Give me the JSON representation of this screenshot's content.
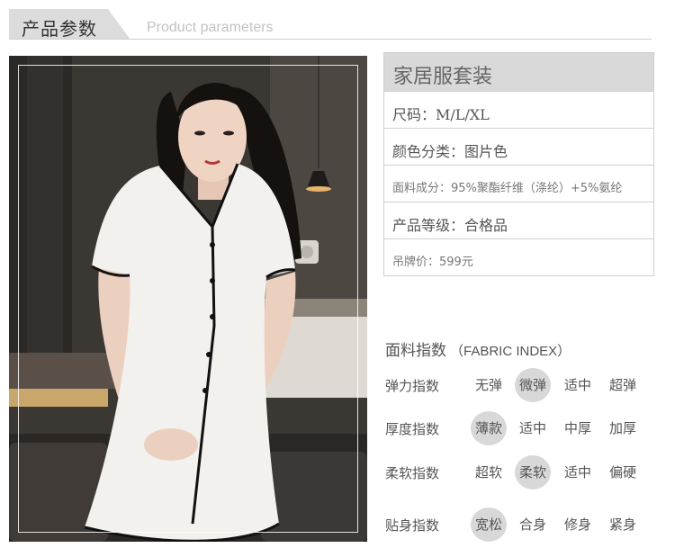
{
  "header": {
    "title": "产品参数",
    "subtitle": "Product parameters"
  },
  "params": {
    "title": "家居服套装",
    "rows": [
      "尺码：M/L/XL",
      "颜色分类：图片色",
      "面料成分：95%聚酯纤维（涤纶）+5%氨纶",
      "产品等级：合格品",
      "吊牌价：599元"
    ]
  },
  "fabric": {
    "title": "面料指数",
    "title_en": "（FABRIC INDEX）",
    "rows": [
      {
        "label": "弹力指数",
        "options": [
          "无弹",
          "微弹",
          "适中",
          "超弹"
        ],
        "selected": 1
      },
      {
        "label": "厚度指数",
        "options": [
          "薄款",
          "适中",
          "中厚",
          "加厚"
        ],
        "selected": 0
      },
      {
        "label": "柔软指数",
        "options": [
          "超软",
          "柔软",
          "适中",
          "偏硬"
        ],
        "selected": 1
      },
      {
        "label": "贴身指数",
        "options": [
          "宽松",
          "合身",
          "修身",
          "紧身"
        ],
        "selected": 0
      }
    ]
  },
  "colors": {
    "selected_bubble": "#d8d8d8",
    "title_bar": "#d9d9d9"
  }
}
